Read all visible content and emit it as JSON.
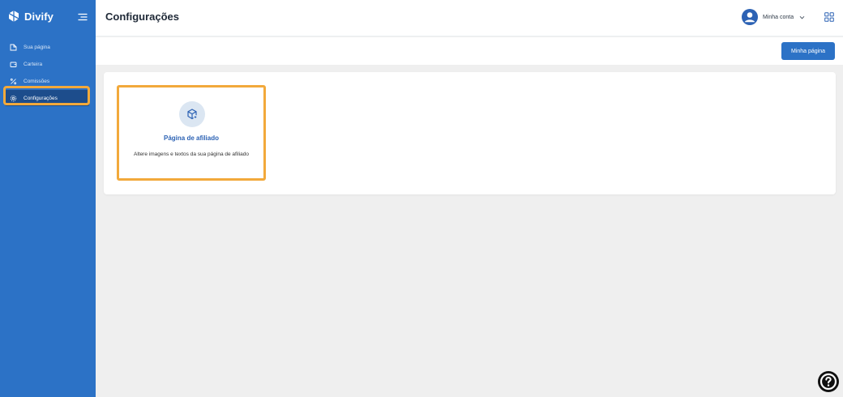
{
  "brand": {
    "name": "Divify"
  },
  "sidebar": {
    "items": [
      {
        "label": "Sua página",
        "icon": "page-icon"
      },
      {
        "label": "Carteira",
        "icon": "wallet-icon"
      },
      {
        "label": "Comissões",
        "icon": "percent-icon"
      },
      {
        "label": "Configurações",
        "icon": "gear-icon",
        "active": true
      }
    ]
  },
  "header": {
    "title": "Configurações",
    "account_label": "Minha conta"
  },
  "toolbar": {
    "primary_button": "Minha página"
  },
  "card": {
    "title": "Página de afiliado",
    "description": "Altere imagens e textos da sua página de afiliado"
  },
  "colors": {
    "sidebar": "#2c72c6",
    "active_item": "#1d4d8c",
    "highlight": "#f2a93b",
    "link": "#2c62b4"
  }
}
